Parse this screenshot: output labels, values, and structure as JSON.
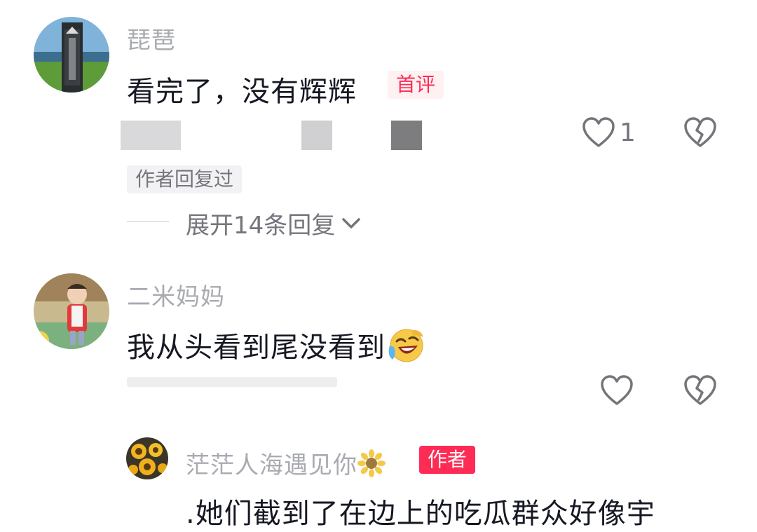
{
  "comments": [
    {
      "username": "琵琶",
      "content": "看完了，没有辉辉",
      "badge": "首评",
      "like_count": "1",
      "author_replied": "作者回复过",
      "expand_label": "展开14条回复",
      "avatar_icon": "avatar-park-sign"
    },
    {
      "username": "二米妈妈",
      "content": "我从头看到尾没看到",
      "content_emoji": "laughing-tears-emoji",
      "avatar_icon": "avatar-child-photo"
    }
  ],
  "reply": {
    "username": "茫茫人海遇见你",
    "username_emoji": "sunflower-emoji",
    "badge": "作者",
    "content": ".她们截到了在边上的吃瓜群众好像宇",
    "avatar_icon": "avatar-sunflowers"
  },
  "colors": {
    "accent": "#fe2c55",
    "primary_text": "#161823",
    "secondary_text": "#a9abb1",
    "meta_text": "#73757b"
  },
  "icons": {
    "like": "heart-outline-icon",
    "dislike": "broken-heart-icon",
    "expand": "chevron-down-icon"
  }
}
